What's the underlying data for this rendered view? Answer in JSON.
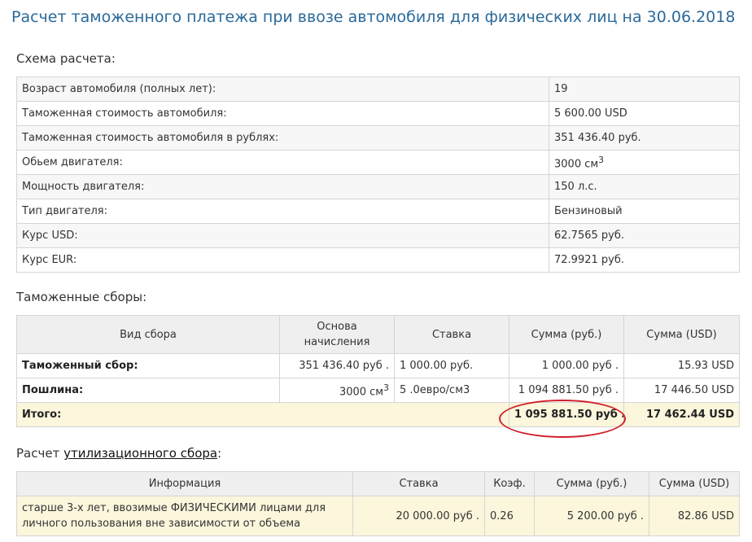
{
  "page_title": "Расчет таможенного платежа при ввозе автомобиля для физических лиц на 30.06.2018",
  "scheme": {
    "title": "Схема расчета:",
    "rows": [
      {
        "label": "Возраст автомобиля (полных лет):",
        "value": "19"
      },
      {
        "label": "Таможенная стоимость автомобиля:",
        "value": "5 600.00 USD"
      },
      {
        "label": "Таможенная стоимость автомобиля в рублях:",
        "value": "351 436.40 руб."
      },
      {
        "label": "Обьем двигателя:",
        "value": "3000 см",
        "sup": "3"
      },
      {
        "label": "Мощность двигателя:",
        "value": "150 л.с."
      },
      {
        "label": "Тип двигателя:",
        "value": "Бензиновый"
      },
      {
        "label": "Курс USD:",
        "value": "62.7565 руб."
      },
      {
        "label": "Курс EUR:",
        "value": "72.9921 руб."
      }
    ]
  },
  "fees": {
    "title": "Таможенные сборы:",
    "headers": [
      "Вид сбора",
      "Основа начисления",
      "Ставка",
      "Сумма (руб.)",
      "Сумма (USD)"
    ],
    "rows": [
      {
        "type": "Таможенный сбор:",
        "base": "351 436.40 руб .",
        "rate": "1 000.00 руб.",
        "rub": "1 000.00 руб .",
        "usd": "15.93 USD"
      },
      {
        "type": "Пошлина:",
        "base": "3000 см",
        "base_sup": "3",
        "rate": "5 .0евро/см3",
        "rub": "1 094 881.50 руб .",
        "usd": "17 446.50 USD"
      }
    ],
    "total": {
      "label": "Итого:",
      "rub": "1 095 881.50 руб .",
      "usd": "17 462.44 USD"
    }
  },
  "util": {
    "title_prefix": "Расчет ",
    "title_link": "утилизационного сбора",
    "title_suffix": ":",
    "headers": [
      "Информация",
      "Ставка",
      "Коэф.",
      "Сумма (руб.)",
      "Сумма (USD)"
    ],
    "row": {
      "info": "старше 3-х лет, ввозимые ФИЗИЧЕСКИМИ лицами для личного пользования вне зависимости от объема",
      "rate": "20 000.00 руб .",
      "coef": "0.26",
      "rub": "5 200.00 руб .",
      "usd": "82.86 USD"
    }
  },
  "colors": {
    "title": "#2a6a9a",
    "highlight_row": "#fbf6dc",
    "annotation_circle": "#d11f2a"
  }
}
